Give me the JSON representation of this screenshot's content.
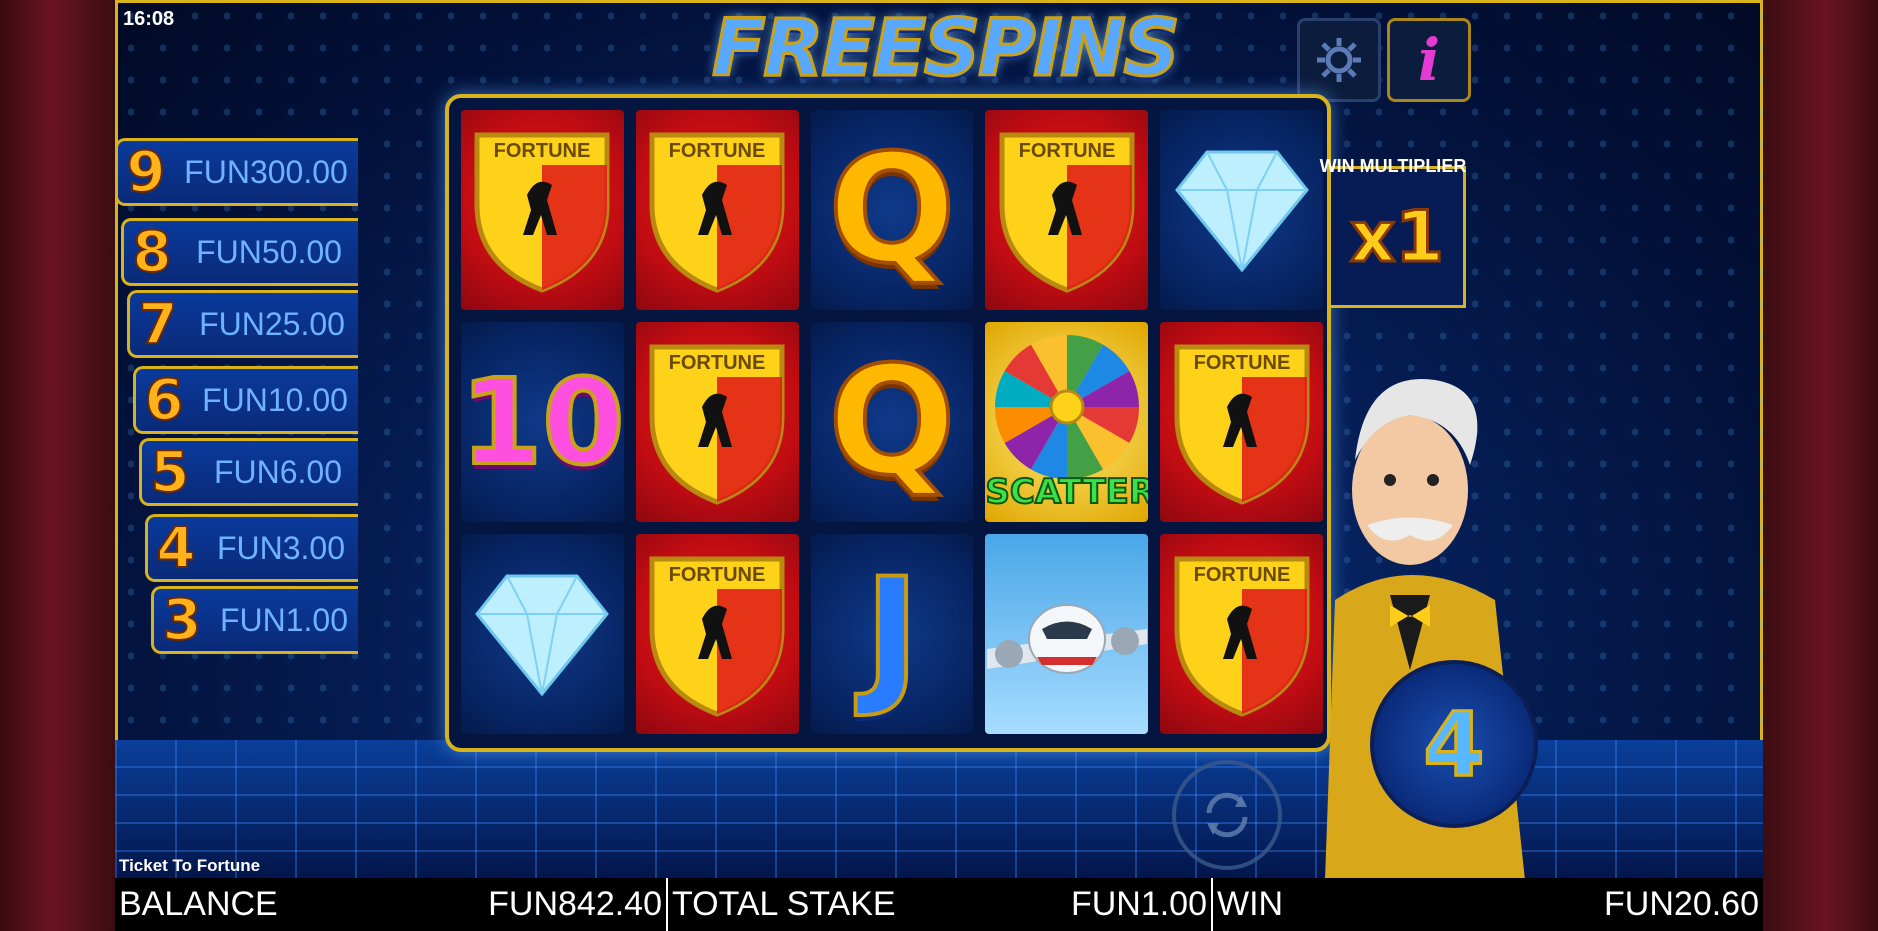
{
  "status": {
    "time": "16:08"
  },
  "title": "FREESPINS",
  "buttons": {
    "settings_icon": "gear-icon",
    "info_icon": "info-icon",
    "info_glyph": "i",
    "autoplay_icon": "refresh-icon"
  },
  "paytable": [
    {
      "count": "9",
      "prize": "FUN300.00"
    },
    {
      "count": "8",
      "prize": "FUN50.00"
    },
    {
      "count": "7",
      "prize": "FUN25.00"
    },
    {
      "count": "6",
      "prize": "FUN10.00"
    },
    {
      "count": "5",
      "prize": "FUN6.00"
    },
    {
      "count": "4",
      "prize": "FUN3.00"
    },
    {
      "count": "3",
      "prize": "FUN1.00"
    }
  ],
  "reels": {
    "symbols": [
      [
        "fortune-shield",
        "fortune-shield",
        "q",
        "fortune-shield",
        "diamond"
      ],
      [
        "ten",
        "fortune-shield",
        "q",
        "wheel-scatter",
        "fortune-shield"
      ],
      [
        "diamond",
        "fortune-shield",
        "j",
        "airplane",
        "fortune-shield"
      ]
    ],
    "shield_text": "FORTUNE",
    "q_text": "Q",
    "j_text": "J",
    "ten_text": "10",
    "scatter_text": "SCATTER"
  },
  "win_multiplier": {
    "label": "WIN MULTIPLIER",
    "value": "x1"
  },
  "free_spins_remaining": "4",
  "game_name": "Ticket To Fortune",
  "bottom_bar": {
    "balance_label": "BALANCE",
    "balance_value": "FUN842.40",
    "stake_label": "TOTAL STAKE",
    "stake_value": "FUN1.00",
    "win_label": "WIN",
    "win_value": "FUN20.60"
  },
  "colors": {
    "gold": "#d9b31c",
    "panel_blue": "#0a2a78",
    "reel_red": "#c00c12"
  }
}
